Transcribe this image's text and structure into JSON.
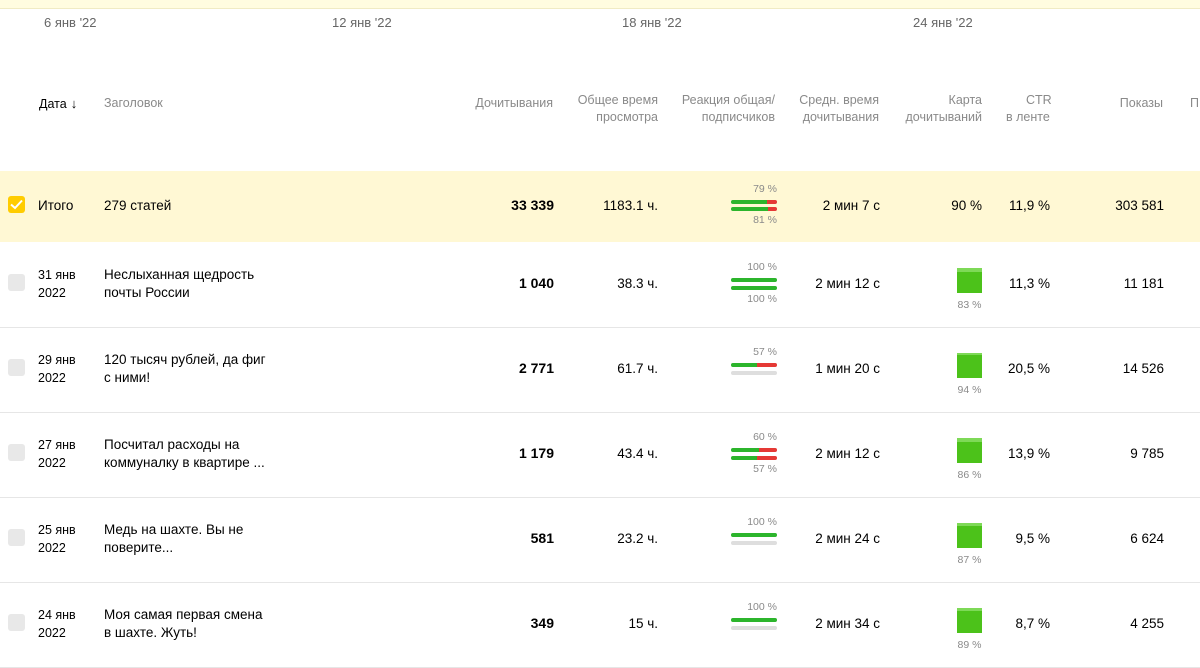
{
  "timeline": [
    "6 янв '22",
    "12 янв '22",
    "18 янв '22",
    "24 янв '22"
  ],
  "columns": {
    "date": "Дата",
    "title": "Заголовок",
    "reads": "Дочитывания",
    "total_time_1": "Общее время",
    "total_time_2": "просмотра",
    "reaction_1": "Реакция общая/",
    "reaction_2": "подписчиков",
    "avg_time_1": "Средн. время",
    "avg_time_2": "дочитывания",
    "map_1": "Карта",
    "map_2": "дочитываний",
    "ctr_1": "CTR",
    "ctr_2": "в ленте",
    "impressions": "Показы",
    "cut": "П"
  },
  "total": {
    "label": "Итого",
    "title": "279 статей",
    "reads": "33 339",
    "total_time": "1183.1 ч.",
    "reaction_top": "79 %",
    "reaction_bottom": "81 %",
    "reaction_top_value": 79,
    "reaction_bottom_value": 81,
    "avg_time": "2 мин 7 с",
    "map": "90 %",
    "ctr": "11,9 %",
    "impressions": "303 581"
  },
  "rows": [
    {
      "date_1": "31 янв",
      "date_2": "2022",
      "title_1": "Неслыханная щедрость",
      "title_2": "почты России",
      "reads": "1 040",
      "total_time": "38.3 ч.",
      "reaction_top": "100 %",
      "reaction_bottom": "100 %",
      "reaction_top_value": 100,
      "reaction_bottom_value": 100,
      "avg_time": "2 мин 12 с",
      "map": "83 %",
      "map_value": 83,
      "ctr": "11,3 %",
      "impressions": "11 181"
    },
    {
      "date_1": "29 янв",
      "date_2": "2022",
      "title_1": "120 тысяч рублей, да фиг",
      "title_2": "с ними!",
      "reads": "2 771",
      "total_time": "61.7 ч.",
      "reaction_top": "57 %",
      "reaction_bottom": "",
      "reaction_top_value": 57,
      "reaction_bottom_value": null,
      "avg_time": "1 мин 20 с",
      "map": "94 %",
      "map_value": 94,
      "ctr": "20,5 %",
      "impressions": "14 526"
    },
    {
      "date_1": "27 янв",
      "date_2": "2022",
      "title_1": "Посчитал расходы на",
      "title_2": "коммуналку в квартире ...",
      "reads": "1 179",
      "total_time": "43.4 ч.",
      "reaction_top": "60 %",
      "reaction_bottom": "57 %",
      "reaction_top_value": 60,
      "reaction_bottom_value": 57,
      "avg_time": "2 мин 12 с",
      "map": "86 %",
      "map_value": 86,
      "ctr": "13,9 %",
      "impressions": "9 785"
    },
    {
      "date_1": "25 янв",
      "date_2": "2022",
      "title_1": "Медь на шахте. Вы не",
      "title_2": "поверите...",
      "reads": "581",
      "total_time": "23.2 ч.",
      "reaction_top": "100 %",
      "reaction_bottom": "",
      "reaction_top_value": 100,
      "reaction_bottom_value": null,
      "avg_time": "2 мин 24 с",
      "map": "87 %",
      "map_value": 87,
      "ctr": "9,5 %",
      "impressions": "6 624"
    },
    {
      "date_1": "24 янв",
      "date_2": "2022",
      "title_1": "Моя самая первая смена",
      "title_2": "в шахте. Жуть!",
      "reads": "349",
      "total_time": "15 ч.",
      "reaction_top": "100 %",
      "reaction_bottom": "",
      "reaction_top_value": 100,
      "reaction_bottom_value": null,
      "avg_time": "2 мин 34 с",
      "map": "89 %",
      "map_value": 89,
      "ctr": "8,7 %",
      "impressions": "4 255"
    }
  ]
}
